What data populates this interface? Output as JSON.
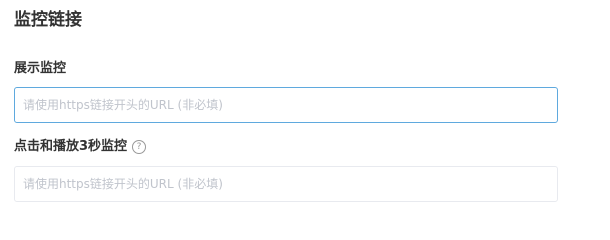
{
  "section": {
    "title": "监控链接"
  },
  "fields": [
    {
      "label": "展示监控",
      "value": "",
      "placeholder": "请使用https链接开头的URL (非必填)"
    },
    {
      "label": "点击和播放3秒监控",
      "value": "",
      "placeholder": "请使用https链接开头的URL (非必填)",
      "help_icon": "question-circle-icon",
      "help_glyph": "?"
    }
  ],
  "colors": {
    "focused_border": "#5fa9de",
    "border": "#e8eaef",
    "placeholder": "#c0c4cc",
    "text": "#333333"
  }
}
